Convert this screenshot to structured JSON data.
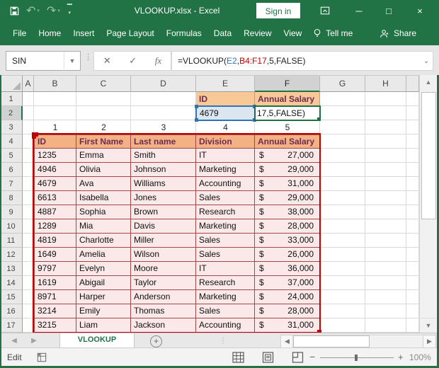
{
  "window": {
    "title": "VLOOKUP.xlsx - Excel",
    "sign_in_label": "Sign in",
    "quick_access": {
      "save": "Save",
      "undo": "Undo",
      "redo": "Redo",
      "customize": "Customize Quick Access Toolbar"
    }
  },
  "ribbon": {
    "tabs": [
      "File",
      "Home",
      "Insert",
      "Page Layout",
      "Formulas",
      "Data",
      "Review",
      "View"
    ],
    "tell_me_label": "Tell me",
    "share_label": "Share"
  },
  "formula_bar": {
    "name_box_value": "SIN",
    "formula_full": "=VLOOKUP(E2,B4:F17,5,FALSE)",
    "formula_parts": [
      {
        "text": "=VLOOKUP(",
        "color": "#1F1F1F"
      },
      {
        "text": "E2",
        "color": "#2E75B6"
      },
      {
        "text": ",",
        "color": "#1F1F1F"
      },
      {
        "text": "B4:F17",
        "color": "#C00000"
      },
      {
        "text": ",5,FALSE)",
        "color": "#1F1F1F"
      }
    ]
  },
  "columns": {
    "labels": [
      "A",
      "B",
      "C",
      "D",
      "E",
      "F",
      "G",
      "H"
    ],
    "widths": [
      16,
      60,
      77,
      92,
      83,
      92,
      64,
      58
    ],
    "selected": "F"
  },
  "rows": {
    "visible": 17,
    "active": 2
  },
  "cells": {
    "e1": "ID",
    "f1": "Annual Salary",
    "e2": "4679",
    "f2_edit_text": "17,5,FALSE)",
    "helper_row3": [
      "1",
      "2",
      "3",
      "4",
      "5"
    ]
  },
  "table": {
    "range": "B4:F17",
    "headers": [
      "ID",
      "First Name",
      "Last name",
      "Division",
      "Annual Salary"
    ],
    "currency_symbol": "$",
    "rows": [
      {
        "id": "1235",
        "first_name": "Emma",
        "last_name": "Smith",
        "division": "IT",
        "salary": "27,000"
      },
      {
        "id": "4946",
        "first_name": "Olivia",
        "last_name": "Johnson",
        "division": "Marketing",
        "salary": "29,000"
      },
      {
        "id": "4679",
        "first_name": "Ava",
        "last_name": "Williams",
        "division": "Accounting",
        "salary": "31,000"
      },
      {
        "id": "6613",
        "first_name": "Isabella",
        "last_name": "Jones",
        "division": "Sales",
        "salary": "29,000"
      },
      {
        "id": "4887",
        "first_name": "Sophia",
        "last_name": "Brown",
        "division": "Research",
        "salary": "38,000"
      },
      {
        "id": "1289",
        "first_name": "Mia",
        "last_name": "Davis",
        "division": "Marketing",
        "salary": "28,000"
      },
      {
        "id": "4819",
        "first_name": "Charlotte",
        "last_name": "Miller",
        "division": "Sales",
        "salary": "33,000"
      },
      {
        "id": "1649",
        "first_name": "Amelia",
        "last_name": "Wilson",
        "division": "Sales",
        "salary": "26,000"
      },
      {
        "id": "9797",
        "first_name": "Evelyn",
        "last_name": "Moore",
        "division": "IT",
        "salary": "36,000"
      },
      {
        "id": "1619",
        "first_name": "Abigail",
        "last_name": "Taylor",
        "division": "Research",
        "salary": "37,000"
      },
      {
        "id": "8971",
        "first_name": "Harper",
        "last_name": "Anderson",
        "division": "Marketing",
        "salary": "24,000"
      },
      {
        "id": "3214",
        "first_name": "Emily",
        "last_name": "Thomas",
        "division": "Sales",
        "salary": "28,000"
      },
      {
        "id": "3215",
        "first_name": "Liam",
        "last_name": "Jackson",
        "division": "Accounting",
        "salary": "31,000"
      }
    ]
  },
  "sheet_bar": {
    "active_tab": "VLOOKUP"
  },
  "status_bar": {
    "mode": "Edit",
    "zoom_level": "100%"
  },
  "colors": {
    "excel_green": "#217346",
    "lookup_header_fill": "#F8C897",
    "table_header_fill": "#F4B183",
    "table_header_text": "#6B2C52",
    "table_row_fill": "#FAE9E8",
    "table_border": "#A04848",
    "range_border_red": "#C00000",
    "reference_blue": "#2E75B6",
    "reference_blue_fill": "#DCE6F1",
    "edit_cell_green": "#1E7145"
  }
}
